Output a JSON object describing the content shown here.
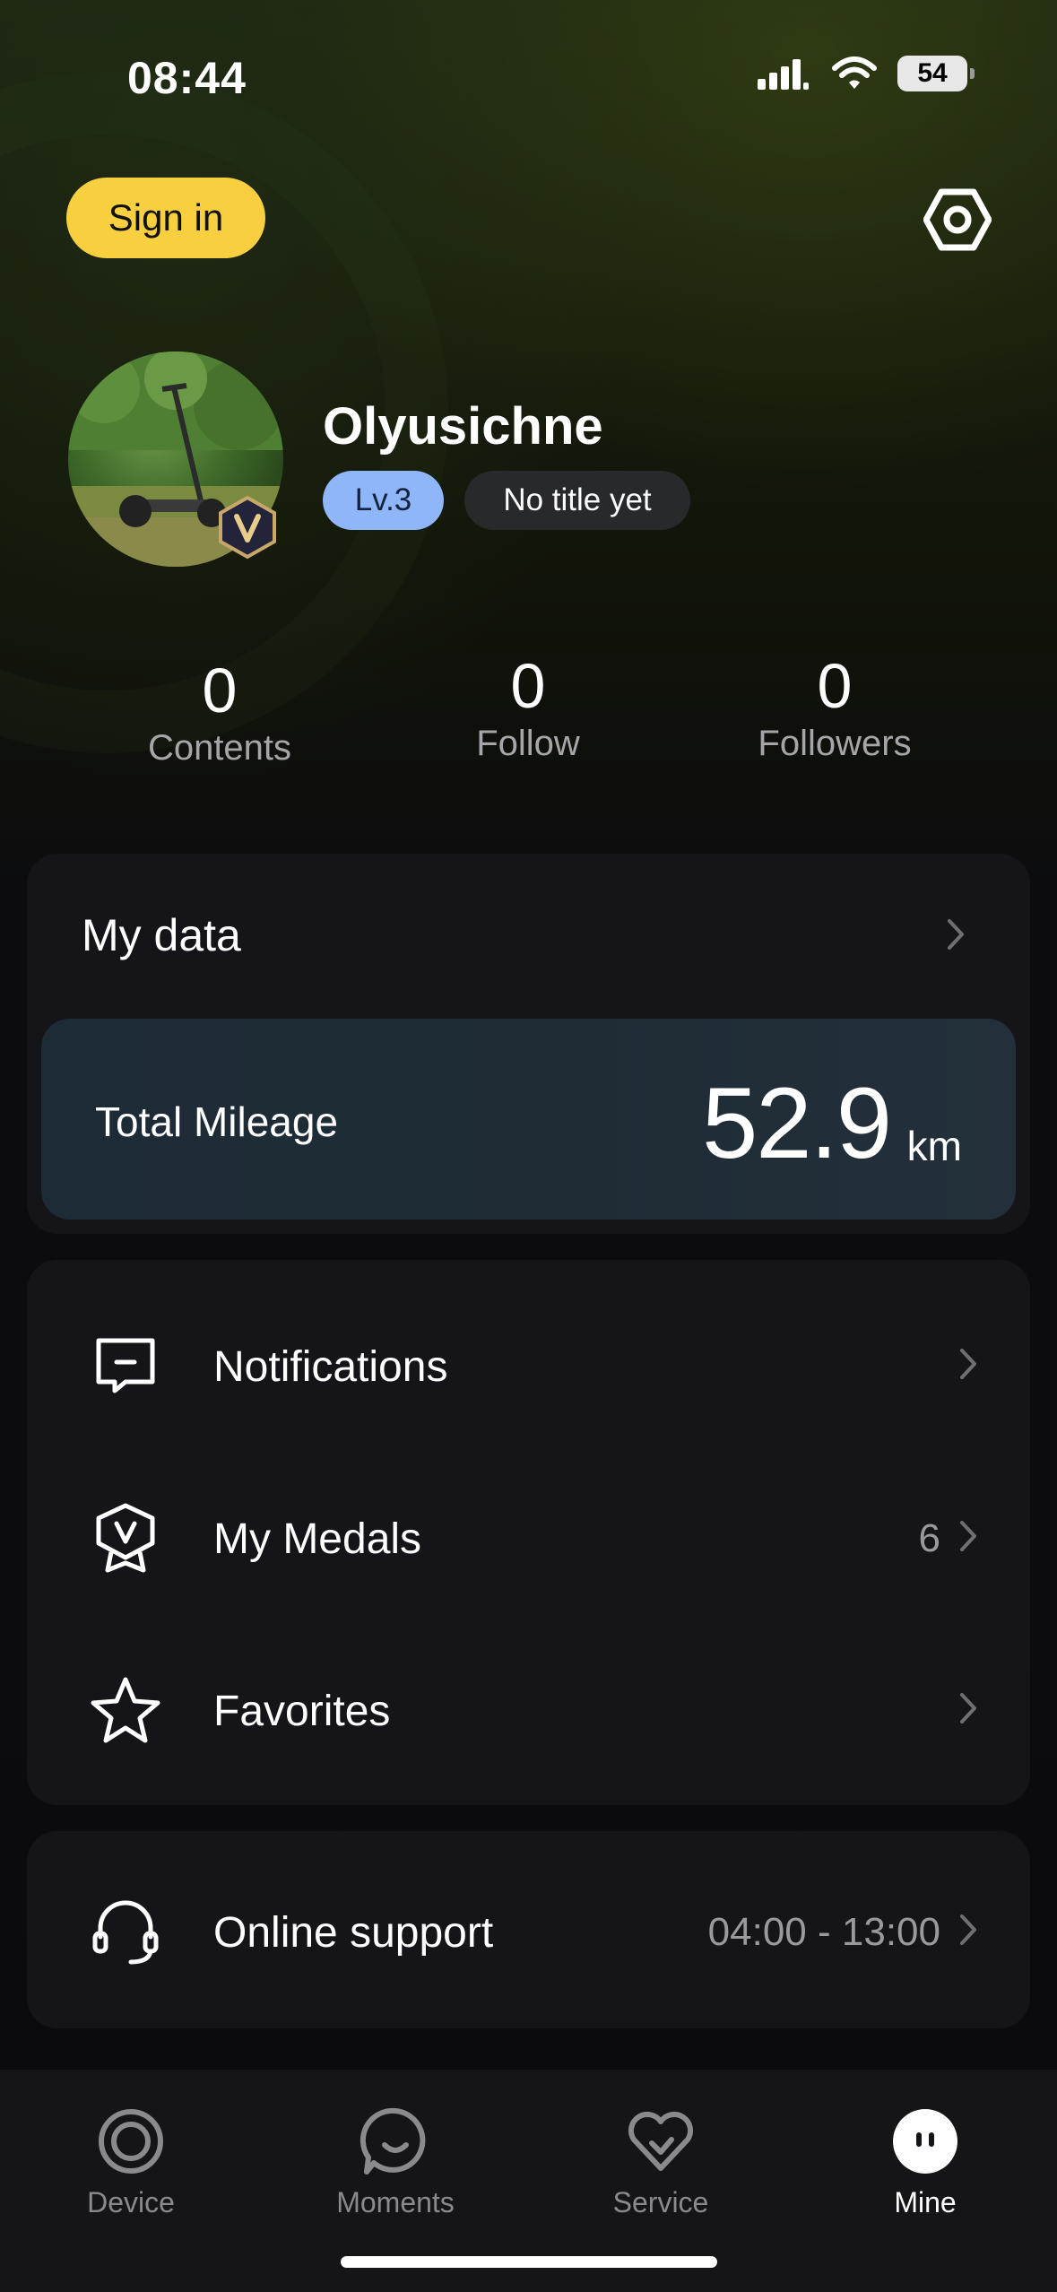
{
  "status_bar": {
    "time": "08:44",
    "battery": "54"
  },
  "header": {
    "signin_label": "Sign in",
    "settings_icon": "settings-hexagon-icon"
  },
  "profile": {
    "username": "Olyusichne",
    "level": "Lv.3",
    "title": "No title yet"
  },
  "stats": [
    {
      "value": "0",
      "label": "Contents"
    },
    {
      "value": "0",
      "label": "Follow"
    },
    {
      "value": "0",
      "label": "Followers"
    }
  ],
  "my_data": {
    "title": "My data",
    "mileage_label": "Total Mileage",
    "mileage_value": "52.9",
    "mileage_unit": "km"
  },
  "menu": [
    {
      "label": "Notifications",
      "value": "",
      "icon": "message-icon"
    },
    {
      "label": "My Medals",
      "value": "6",
      "icon": "medal-icon"
    },
    {
      "label": "Favorites",
      "value": "",
      "icon": "star-icon"
    }
  ],
  "support": {
    "label": "Online support",
    "hours": "04:00 - 13:00",
    "icon": "headset-icon"
  },
  "tabs": [
    {
      "label": "Device",
      "icon": "device-icon",
      "active": false
    },
    {
      "label": "Moments",
      "icon": "moments-icon",
      "active": false
    },
    {
      "label": "Service",
      "icon": "service-heart-icon",
      "active": false
    },
    {
      "label": "Mine",
      "icon": "mine-icon",
      "active": true
    }
  ],
  "colors": {
    "accent_yellow": "#f8cf3f",
    "level_blue": "#8fb6f8",
    "card_bg": "#151519"
  }
}
